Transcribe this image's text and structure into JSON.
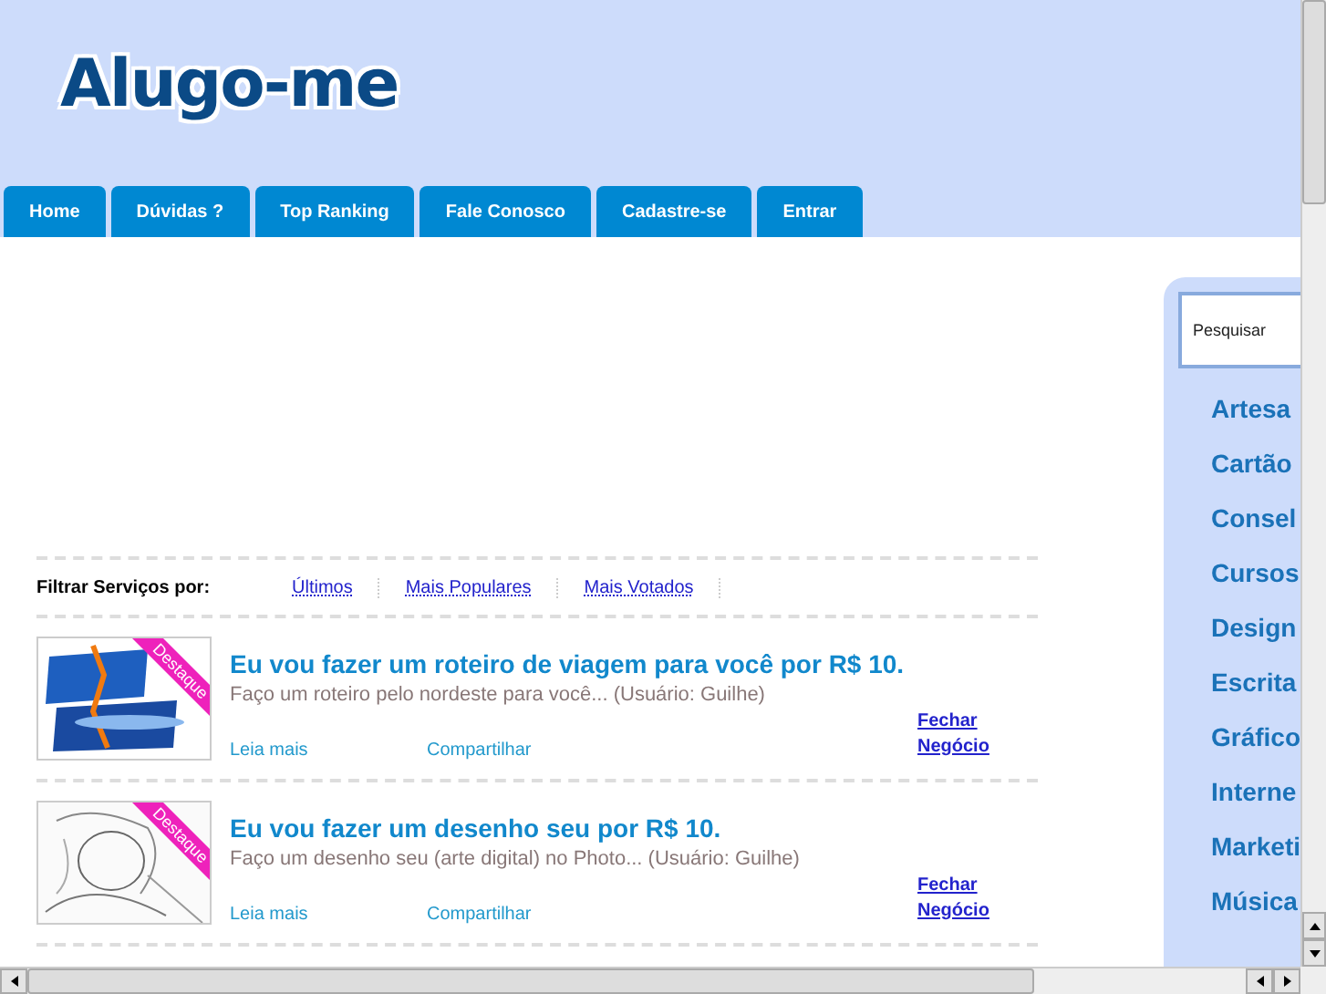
{
  "logo": "Alugo-me",
  "tabs": [
    {
      "label": "Home"
    },
    {
      "label": "Dúvidas ?"
    },
    {
      "label": "Top Ranking"
    },
    {
      "label": "Fale Conosco"
    },
    {
      "label": "Cadastre-se"
    },
    {
      "label": "Entrar"
    }
  ],
  "filter": {
    "label": "Filtrar Serviços por:",
    "links": [
      "Últimos",
      "Mais Populares",
      "Mais Votados"
    ]
  },
  "services": [
    {
      "badge": "Destaque",
      "title": "Eu vou fazer um roteiro de viagem para você por R$ 10.",
      "description": "Faço um roteiro pelo nordeste para você... (Usuário: Guilhe)",
      "read_more": "Leia mais",
      "share": "Compartilhar",
      "close_deal": "Fechar Negócio"
    },
    {
      "badge": "Destaque",
      "title": "Eu vou fazer um desenho seu por R$ 10.",
      "description": "Faço um desenho seu (arte digital) no Photo... (Usuário: Guilhe)",
      "read_more": "Leia mais",
      "share": "Compartilhar",
      "close_deal": "Fechar Negócio"
    }
  ],
  "sidebar": {
    "search_placeholder": "Pesquisar",
    "categories": [
      "Artesa",
      "Cartão",
      "Consel",
      "Cursos",
      "Design",
      "Escrita",
      "Gráfico",
      "Interne",
      "Marketi",
      "Música"
    ]
  }
}
